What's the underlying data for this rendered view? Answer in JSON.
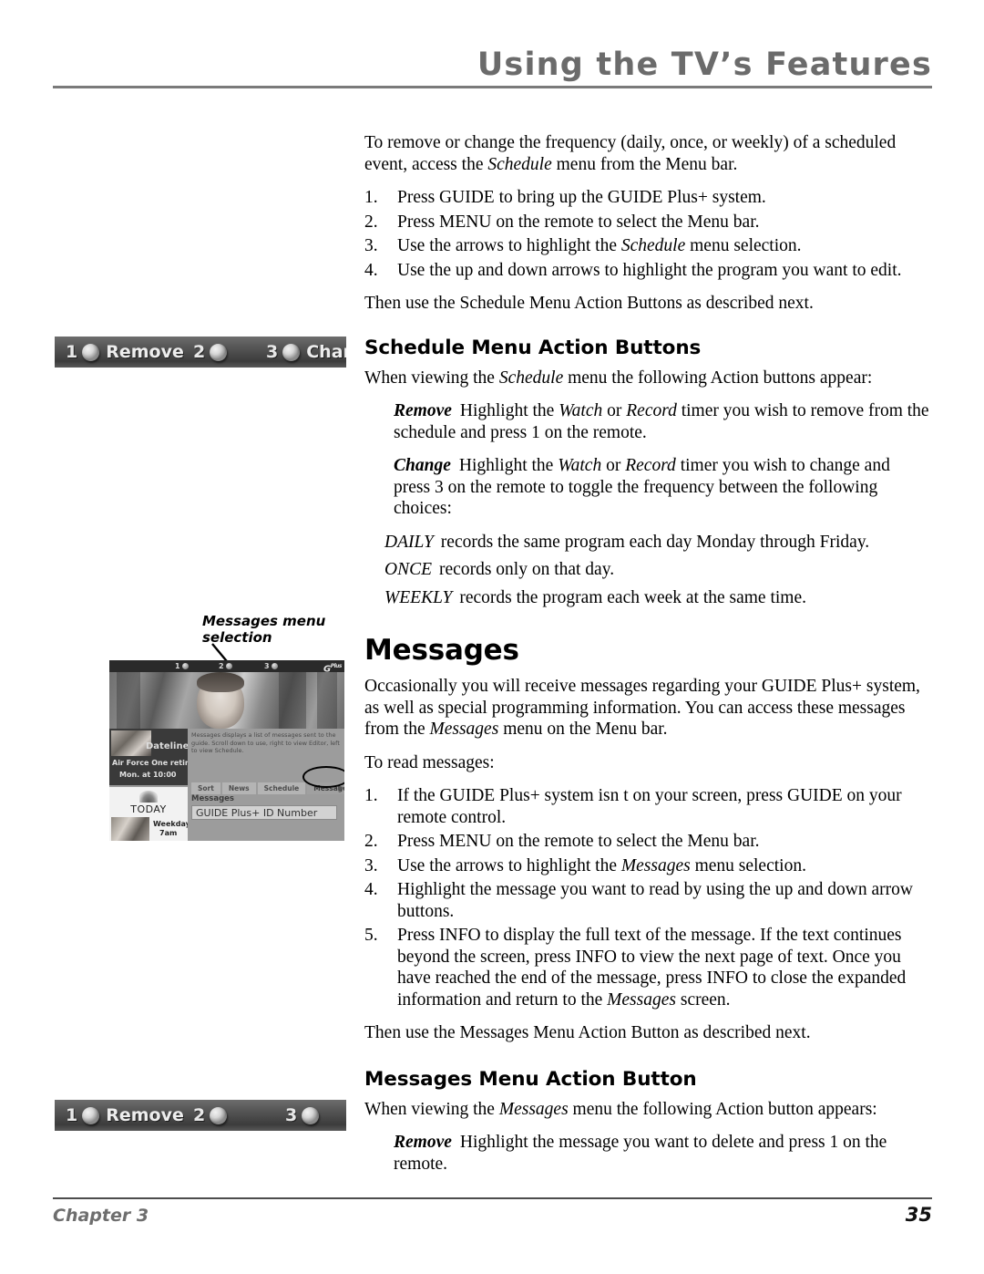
{
  "header": {
    "title": "Using the TV’s Features"
  },
  "intro": {
    "para1_a": "To remove or change the frequency (daily, once, or weekly) of a scheduled event, access the ",
    "para1_em": "Schedule",
    "para1_b": " menu from the Menu bar.",
    "steps": [
      {
        "num": "1.",
        "a": "Press GUIDE to bring up the GUIDE Plus+ system.",
        "em": "",
        "b": ""
      },
      {
        "num": "2.",
        "a": "Press MENU on the remote to select the Menu bar.",
        "em": "",
        "b": ""
      },
      {
        "num": "3.",
        "a": "Use the arrows to highlight the ",
        "em": "Schedule",
        "b": " menu selection."
      },
      {
        "num": "4.",
        "a": "Use the up and down arrows to highlight the program you want to edit.",
        "em": "",
        "b": ""
      }
    ],
    "closing": "Then use the Schedule Menu Action Buttons as described next."
  },
  "schedule_section": {
    "heading": "Schedule Menu Action Buttons",
    "intro_a": "When viewing the ",
    "intro_em": "Schedule",
    "intro_b": " menu the following Action buttons appear:",
    "remove_lead": "Remove",
    "remove_a": "Highlight the ",
    "remove_em1": "Watch",
    "remove_mid": " or ",
    "remove_em2": "Record",
    "remove_b": " timer you wish to remove from the schedule and press 1 on the remote.",
    "change_lead": "Change",
    "change_a": "Highlight the ",
    "change_em1": "Watch",
    "change_mid": " or ",
    "change_em2": "Record",
    "change_b": " timer you wish to change and press 3 on the remote to toggle the frequency between the following choices:",
    "choices": [
      {
        "kw": "DAILY",
        "text": "records the same program each day Monday through Friday."
      },
      {
        "kw": "ONCE",
        "text": "records only on that day."
      },
      {
        "kw": "WEEKLY",
        "text": "records the program each week at the same time."
      }
    ]
  },
  "action_bar_schedule": {
    "slots": [
      {
        "num": "1",
        "label": "Remove"
      },
      {
        "num": "2",
        "label": ""
      },
      {
        "num": "3",
        "label": "Change"
      }
    ]
  },
  "action_bar_messages": {
    "slots": [
      {
        "num": "1",
        "label": "Remove"
      },
      {
        "num": "2",
        "label": ""
      },
      {
        "num": "3",
        "label": ""
      }
    ]
  },
  "figure": {
    "caption_line1": "Messages menu",
    "caption_line2": "selection"
  },
  "tv_screen": {
    "topbar": [
      {
        "num": "1"
      },
      {
        "num": "2"
      },
      {
        "num": "3"
      }
    ],
    "logo_main": "G",
    "logo_sup": "Plus",
    "ad1": {
      "title": "Dateline",
      "line1": "Air Force One retires",
      "line2": "Mon. at 10:00"
    },
    "ad2": {
      "title": "TODAY",
      "line1": "Weekdays",
      "line2": "7am"
    },
    "description": "Messages displays a list of messages sent to the guide. Scroll down to use, right to view Editor, left to view Schedule.",
    "menu_items": [
      "Sort",
      "News",
      "Schedule",
      "Messages"
    ],
    "selected_menu_item": "Messages",
    "arrow_glyph": "▶",
    "messages_label": "Messages",
    "id_row": "GUIDE Plus+ ID Number"
  },
  "messages_section": {
    "heading": "Messages",
    "para1_a": "Occasionally you will receive messages regarding your GUIDE Plus+ system, as well as special programming information.  You can access these messages from the ",
    "para1_em": "Messages",
    "para1_b": " menu on the Menu bar.",
    "lead_in": "To read messages:",
    "steps": [
      {
        "num": "1.",
        "a": "If the GUIDE Plus+ system isn t on your screen, press GUIDE on your remote control.",
        "em": "",
        "b": ""
      },
      {
        "num": "2.",
        "a": "Press MENU on the remote to select the Menu bar.",
        "em": "",
        "b": ""
      },
      {
        "num": "3.",
        "a": "Use the arrows to highlight the ",
        "em": "Messages",
        "b": " menu selection."
      },
      {
        "num": "4.",
        "a": "Highlight the message you want to read by using the up and down arrow buttons.",
        "em": "",
        "b": ""
      },
      {
        "num": "5.",
        "a": "Press INFO to display the full text of the message. If the text continues beyond the screen, press INFO to view the next page of text. Once you have reached the end of the message, press INFO to close the expanded information and return to the ",
        "em": "Messages",
        "b": " screen."
      }
    ],
    "closing": "Then use the Messages Menu Action Button as described next."
  },
  "messages_buttons_section": {
    "heading": "Messages Menu Action Button",
    "intro_a": "When viewing the ",
    "intro_em": "Messages",
    "intro_b": " menu the following Action button appears:",
    "remove_lead": "Remove",
    "remove_text": "Highlight the message you want to delete and press 1 on the remote."
  },
  "footer": {
    "chapter": "Chapter 3",
    "page": "35"
  }
}
